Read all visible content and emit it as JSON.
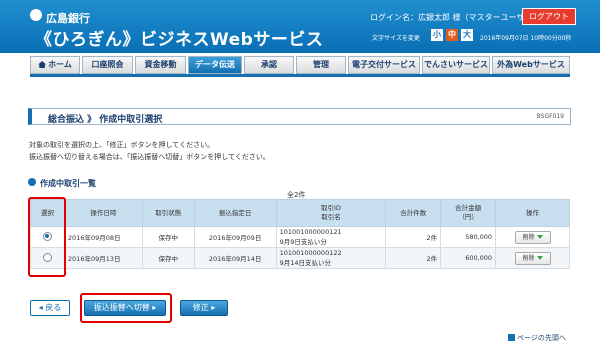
{
  "header": {
    "bank_name": "広島銀行",
    "service_name": "《ひろぎん》ビジネスWebサービス",
    "login_name": "ログイン名：広銀太郎 様（マスターユーザ）",
    "logout_label": "ログアウト",
    "fontsize_label": "文字サイズを変更",
    "fontsize_small": "小",
    "fontsize_mid": "中",
    "fontsize_large": "大",
    "datetime": "2016年09月07日 10時00分00秒"
  },
  "nav": {
    "items": [
      "ホーム",
      "口座照会",
      "資金移動",
      "データ伝送",
      "承認",
      "管理",
      "電子交付サービス",
      "でんさいサービス",
      "外為Webサービス"
    ]
  },
  "page": {
    "title": "総合振込 》 作成中取引選択",
    "screen_id": "BSGF019",
    "instruction1": "対象の取引を選択の上、「修正」ボタンを押してください。",
    "instruction2": "振込振替へ切り替える場合は、「振込振替へ切替」ボタンを押してください。",
    "section_title": "作成中取引一覧",
    "total_count": "全2件"
  },
  "table": {
    "headers": {
      "select": "選択",
      "op_date": "操作日時",
      "status": "取引状態",
      "transfer_date": "振込指定日",
      "txn_id": "取引ID",
      "txn_name": "取引名",
      "total_count": "合計件数",
      "total_amount": "合計金額",
      "total_amount_unit": "（円）",
      "action": "操作"
    },
    "rows": [
      {
        "op_date": "2016年09月08日",
        "status": "保存中",
        "transfer_date": "2016年09月09日",
        "txn_id": "101001000000121",
        "txn_name": "9月9日支払い分",
        "count": "2件",
        "amount": "580,000",
        "action": "削除"
      },
      {
        "op_date": "2016年09月13日",
        "status": "保存中",
        "transfer_date": "2016年09月14日",
        "txn_id": "101001000000122",
        "txn_name": "9月14日支払い分",
        "count": "2件",
        "amount": "600,000",
        "action": "削除"
      }
    ]
  },
  "buttons": {
    "back": "戻る",
    "switch": "振込振替へ切替",
    "edit": "修正",
    "page_top": "ページの先頭へ"
  }
}
